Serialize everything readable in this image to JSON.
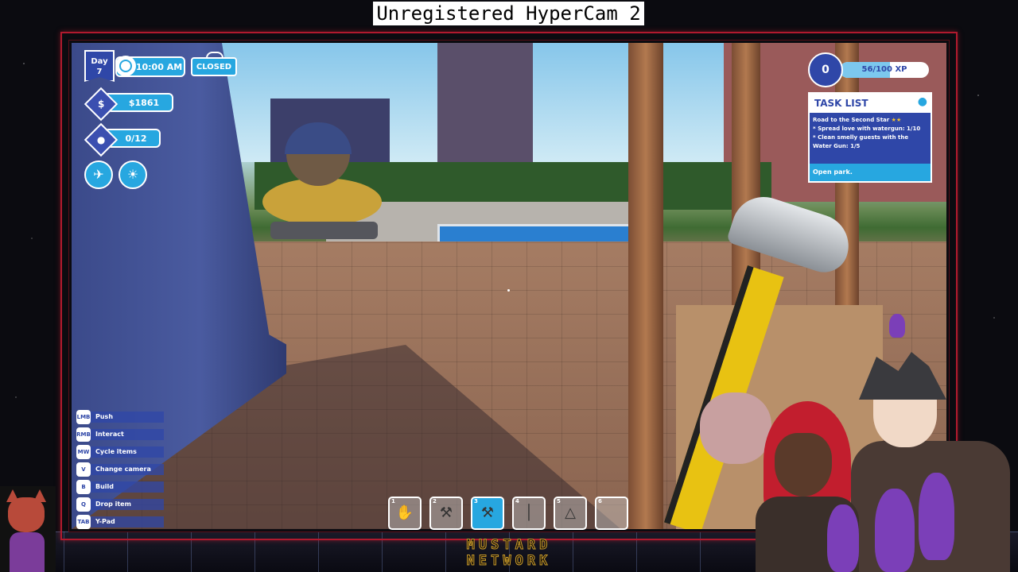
{
  "overlay": {
    "recorder_banner": "Unregistered HyperCam 2",
    "network_logo": [
      "MUSTARD",
      "NETWORK"
    ]
  },
  "hud": {
    "day_label": "Day",
    "day_number": "7",
    "time": "10:00 AM",
    "park_status": "CLOSED",
    "money": "$1861",
    "guests": "0/12",
    "mode_buttons": [
      {
        "icon": "plane-cleaning-icon"
      },
      {
        "icon": "island-icon"
      }
    ]
  },
  "xp": {
    "level": "0",
    "level_icon": "flask-icon",
    "text": "56/100",
    "suffix": "XP",
    "progress": 0.56
  },
  "task_list": {
    "title": "TASK LIST",
    "quest": "Road to the Second Star",
    "quest_stars": "★★",
    "tasks": [
      "* Spread love with watergun: 1/10",
      "* Clean smelly guests with the Water Gun: 1/5"
    ],
    "footer": "Open park."
  },
  "controls": [
    {
      "key": "LMB",
      "label": "Push"
    },
    {
      "key": "RMB",
      "label": "Interact"
    },
    {
      "key": "MW",
      "label": "Cycle items"
    },
    {
      "key": "V",
      "label": "Change camera"
    },
    {
      "key": "B",
      "label": "Build"
    },
    {
      "key": "Q",
      "label": "Drop item"
    },
    {
      "key": "TAB",
      "label": "Y-Pad"
    }
  ],
  "hotbar": {
    "selected_index": 2,
    "slots": [
      {
        "num": "1",
        "icon": "hand-icon"
      },
      {
        "num": "2",
        "icon": "hammer-icon"
      },
      {
        "num": "3",
        "icon": "hammer-icon"
      },
      {
        "num": "4",
        "icon": "mop-icon"
      },
      {
        "num": "5",
        "icon": "plunger-icon"
      },
      {
        "num": "6",
        "icon": "empty-slot"
      }
    ]
  },
  "colors": {
    "hud_blue": "#27a7e0",
    "hud_navy": "#2f47a8",
    "frame_red": "#b01a2e"
  }
}
